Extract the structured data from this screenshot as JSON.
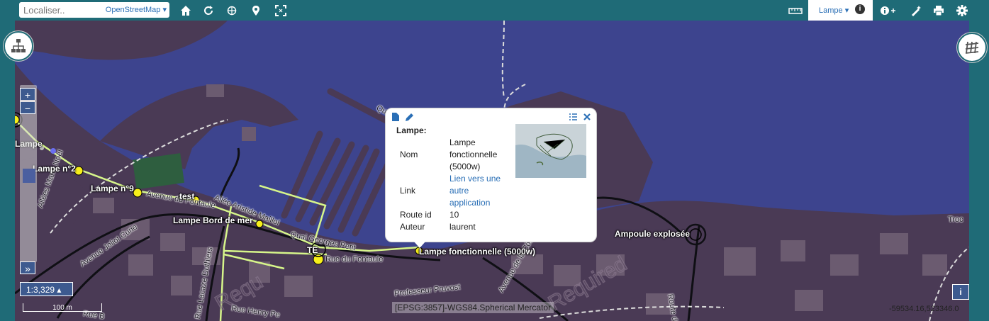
{
  "topbar": {
    "search_placeholder": "Localiser..",
    "provider": "OpenStreetMap",
    "layer_tab": "Lampe",
    "icons": [
      "home-icon",
      "refresh-icon",
      "globe-icon",
      "marker-icon",
      "fullscreen-icon",
      "ruler-icon",
      "info-icon",
      "info-plus-icon",
      "draw-icon",
      "print-icon",
      "settings-icon"
    ]
  },
  "map": {
    "labels": [
      {
        "text": "Allées Marie Noël"
      },
      {
        "text": "Avenue Joliot Curie"
      },
      {
        "text": "Avenue du Fontaule"
      },
      {
        "text": "Allée Aristide Maillol"
      },
      {
        "text": "Quai Georges Petit"
      },
      {
        "text": "Rue du Fontaule"
      },
      {
        "text": "Rue Lacaze Duthiers"
      },
      {
        "text": "Rue Henry Pe"
      },
      {
        "text": "Professeur Pruvost"
      },
      {
        "text": "Avenue de la Côte Vermeille"
      },
      {
        "text": "Route d"
      },
      {
        "text": "Troc"
      },
      {
        "text": "Rue B"
      },
      {
        "text": "Qu"
      }
    ],
    "features": [
      {
        "text": "Lampe"
      },
      {
        "text": "Lampe n°2"
      },
      {
        "text": "Lampe n°9"
      },
      {
        "text": "test"
      },
      {
        "text": "Lampe Bord de mer"
      },
      {
        "text": "TE"
      },
      {
        "text": "Lampe fonctionnelle (5000w)"
      },
      {
        "text": "Ampoule explosée"
      }
    ],
    "watermark": "Required"
  },
  "controls": {
    "zoom_in": "+",
    "zoom_out": "−",
    "expand": "»",
    "scale": "1:3,329 ▴",
    "scale_bar": "100 m",
    "projection": "[EPSG:3857]-WGS84.Spherical Mercator",
    "coordinates": "-59534.16,523346.0",
    "info": "i"
  },
  "popup": {
    "title": "Lampe:",
    "rows": [
      {
        "key": "Nom",
        "value": "Lampe fonctionnelle (5000w)"
      },
      {
        "key": "Link",
        "value": "Lien vers une autre application"
      },
      {
        "key": "Route id",
        "value": "10"
      },
      {
        "key": "Auteur",
        "value": "laurent"
      }
    ]
  },
  "colors": {
    "toolbar": "#1f6b77",
    "water": "#3d448e",
    "land": "#4a3a55",
    "feature_line": "#d6f58a",
    "marker": "#f7ef1a",
    "link": "#2a6fb6"
  }
}
